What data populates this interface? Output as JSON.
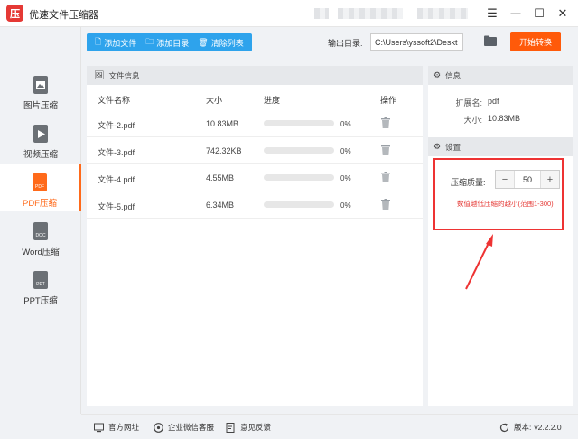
{
  "app": {
    "logo_glyph": "压",
    "title": "优速文件压缩器"
  },
  "window": {
    "menu_glyph": "☰",
    "minimize_glyph": "—",
    "maximize_glyph": "☐",
    "close_glyph": "✕"
  },
  "toolbar": {
    "add_file_label": "添加文件",
    "add_dir_label": "添加目录",
    "clear_list_label": "清除列表",
    "output_label": "输出目录:",
    "output_path": "C:\\Users\\yssoft2\\Deskt",
    "start_label": "开始转换"
  },
  "sidebar": {
    "items": [
      {
        "label": "图片压缩",
        "icon_text": "",
        "active": false
      },
      {
        "label": "视频压缩",
        "icon_text": "",
        "active": false
      },
      {
        "label": "PDF压缩",
        "icon_text": "PDF",
        "active": true
      },
      {
        "label": "Word压缩",
        "icon_text": "DOC",
        "active": false
      },
      {
        "label": "PPT压缩",
        "icon_text": "PPT",
        "active": false
      }
    ]
  },
  "file_panel": {
    "header": "文件信息",
    "columns": {
      "name": "文件名称",
      "size": "大小",
      "progress": "进度",
      "action": "操作"
    },
    "rows": [
      {
        "name": "文件-2.pdf",
        "size": "10.83MB",
        "progress": 0,
        "progress_text": "0%"
      },
      {
        "name": "文件-3.pdf",
        "size": "742.32KB",
        "progress": 0,
        "progress_text": "0%"
      },
      {
        "name": "文件-4.pdf",
        "size": "4.55MB",
        "progress": 0,
        "progress_text": "0%"
      },
      {
        "name": "文件-5.pdf",
        "size": "6.34MB",
        "progress": 0,
        "progress_text": "0%"
      }
    ]
  },
  "info_panel": {
    "header": "信息",
    "ext_label": "扩展名:",
    "ext_value": "pdf",
    "size_label": "大小:",
    "size_value": "10.83MB"
  },
  "settings_panel": {
    "header": "设置",
    "quality_label": "压缩质量:",
    "quality_value": "50",
    "minus_glyph": "−",
    "plus_glyph": "+",
    "hint": "数值越低压缩的越小(范围1-300)"
  },
  "footer": {
    "website": "官方网址",
    "wechat": "企业微信客服",
    "feedback": "意见反馈",
    "version_label": "版本:",
    "version": "v2.2.2.0"
  },
  "colors": {
    "accent_blue": "#2ea3ec",
    "accent_orange": "#ff5a0a",
    "highlight_red": "#e53935"
  }
}
